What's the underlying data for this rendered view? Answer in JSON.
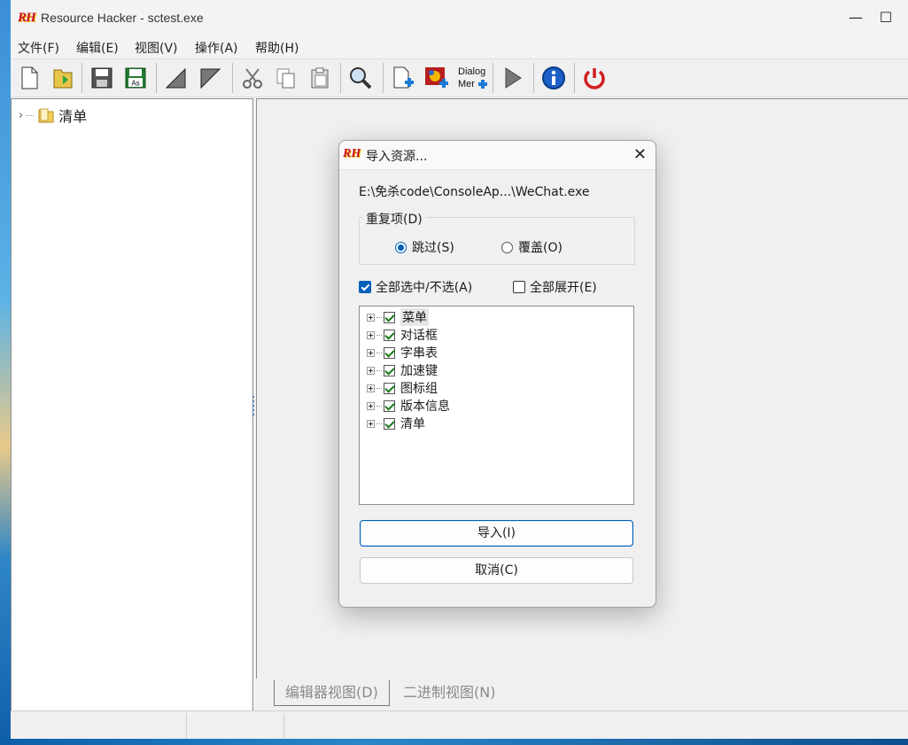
{
  "window": {
    "title": "Resource Hacker - sctest.exe",
    "logo_text": "RH"
  },
  "menu": [
    "文件(F)",
    "编辑(E)",
    "视图(V)",
    "操作(A)",
    "帮助(H)"
  ],
  "toolbar": {
    "items": [
      "new-file-icon",
      "open-file-icon",
      "save-icon",
      "save-as-icon",
      "compile-icon",
      "export-icon",
      "cut-icon",
      "copy-icon",
      "paste-icon",
      "find-icon",
      "add-resource-icon",
      "add-image-icon",
      "dialog-menu-icon",
      "run-script-icon",
      "info-icon",
      "exit-icon"
    ],
    "save_as_label": "As",
    "dialog_menu_label_1": "Dialog",
    "dialog_menu_label_2": "Mer"
  },
  "tree": {
    "root_label": "清单"
  },
  "tabs": {
    "editor": "编辑器视图(D)",
    "binary": "二进制视图(N)"
  },
  "dialog": {
    "logo_text": "RH",
    "title": "导入资源...",
    "path": "E:\\免杀code\\ConsoleAp...\\WeChat.exe",
    "duplicates_group": "重复项(D)",
    "radio_skip": "跳过(S)",
    "radio_overwrite": "覆盖(O)",
    "selected_radio": "skip",
    "check_all": "全部选中/不选(A)",
    "check_all_checked": true,
    "expand_all": "全部展开(E)",
    "expand_all_checked": false,
    "resources": [
      "菜单",
      "对话框",
      "字串表",
      "加速键",
      "图标组",
      "版本信息",
      "清单"
    ],
    "import_button": "导入(I)",
    "cancel_button": "取消(C)"
  },
  "colors": {
    "accent": "#005fb8",
    "logo_red": "#c8102e",
    "exit_red": "#d21f1f",
    "info_blue": "#1c5fc7"
  }
}
